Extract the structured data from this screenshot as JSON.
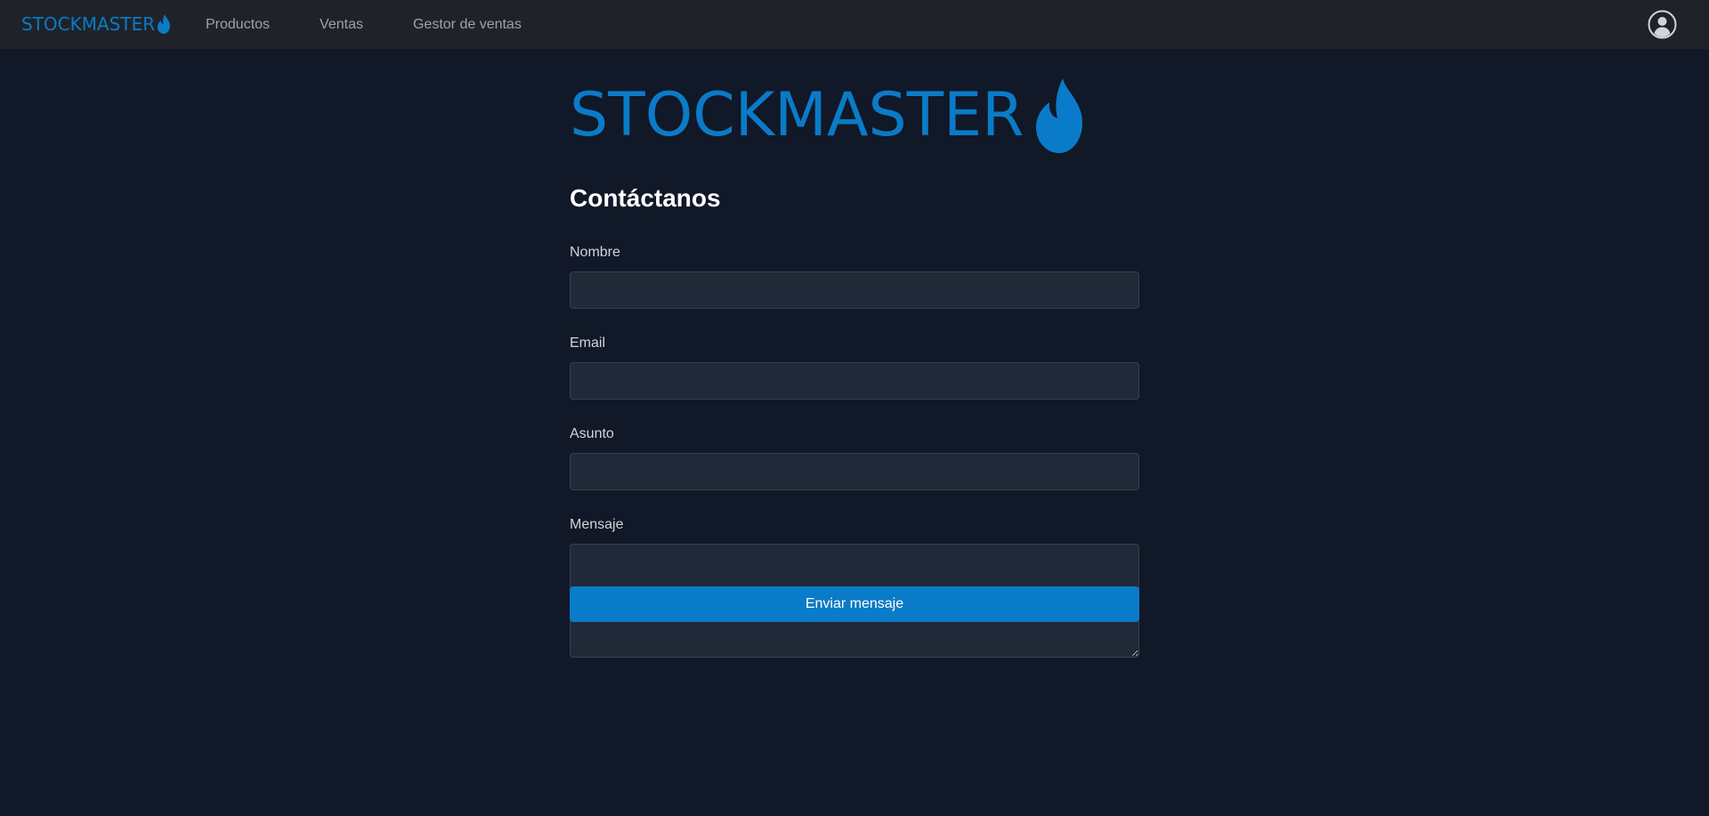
{
  "app": {
    "brand_name": "STOCKMASTER",
    "brand_color": "#0a7bc8"
  },
  "navbar": {
    "links": [
      {
        "label": "Productos"
      },
      {
        "label": "Ventas"
      },
      {
        "label": "Gestor de ventas"
      }
    ],
    "profile_icon": "user-circle-icon"
  },
  "hero": {
    "logo_text": "STOCKMASTER",
    "logo_icon": "flame-icon"
  },
  "page": {
    "title": "Contáctanos"
  },
  "form": {
    "fields": [
      {
        "label": "Nombre",
        "value": "",
        "placeholder": ""
      },
      {
        "label": "Email",
        "value": "",
        "placeholder": ""
      },
      {
        "label": "Asunto",
        "value": "",
        "placeholder": ""
      },
      {
        "label": "Mensaje",
        "value": "",
        "placeholder": ""
      }
    ],
    "submit_label": "Enviar mensaje"
  },
  "colors": {
    "background": "#111827",
    "navbar": "#1f2329",
    "input_background": "#1f2937",
    "accent": "#0a7bc8"
  }
}
